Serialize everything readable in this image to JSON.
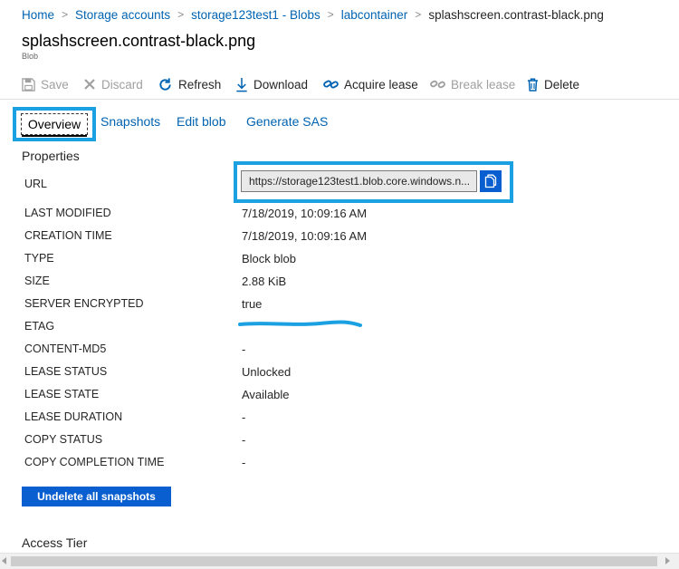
{
  "breadcrumb": {
    "items": [
      "Home",
      "Storage accounts",
      "storage123test1 - Blobs",
      "labcontainer"
    ],
    "current": "splashscreen.contrast-black.png",
    "separator": ">"
  },
  "header": {
    "title": "splashscreen.contrast-black.png",
    "subtitle": "Blob"
  },
  "toolbar": {
    "save": "Save",
    "discard": "Discard",
    "refresh": "Refresh",
    "download": "Download",
    "acquire_lease": "Acquire lease",
    "break_lease": "Break lease",
    "delete": "Delete"
  },
  "tabs": {
    "overview": "Overview",
    "snapshots": "Snapshots",
    "edit_blob": "Edit blob",
    "generate_sas": "Generate SAS"
  },
  "properties": {
    "heading": "Properties",
    "url_label": "URL",
    "url_value": "https://storage123test1.blob.core.windows.n...",
    "rows": [
      {
        "label": "LAST MODIFIED",
        "value": "7/18/2019, 10:09:16 AM"
      },
      {
        "label": "CREATION TIME",
        "value": "7/18/2019, 10:09:16 AM"
      },
      {
        "label": "TYPE",
        "value": "Block blob"
      },
      {
        "label": "SIZE",
        "value": "2.88 KiB"
      },
      {
        "label": "SERVER ENCRYPTED",
        "value": "true"
      },
      {
        "label": "ETAG",
        "value": ""
      },
      {
        "label": "CONTENT-MD5",
        "value": "-"
      },
      {
        "label": "LEASE STATUS",
        "value": "Unlocked"
      },
      {
        "label": "LEASE STATE",
        "value": "Available"
      },
      {
        "label": "LEASE DURATION",
        "value": "-"
      },
      {
        "label": "COPY STATUS",
        "value": "-"
      },
      {
        "label": "COPY COMPLETION TIME",
        "value": "-"
      }
    ]
  },
  "actions": {
    "undelete": "Undelete all snapshots"
  },
  "access_tier": {
    "heading": "Access Tier"
  },
  "colors": {
    "link": "#0063b1",
    "highlight": "#1ba1e2",
    "primary_button": "#0a5fd0"
  }
}
